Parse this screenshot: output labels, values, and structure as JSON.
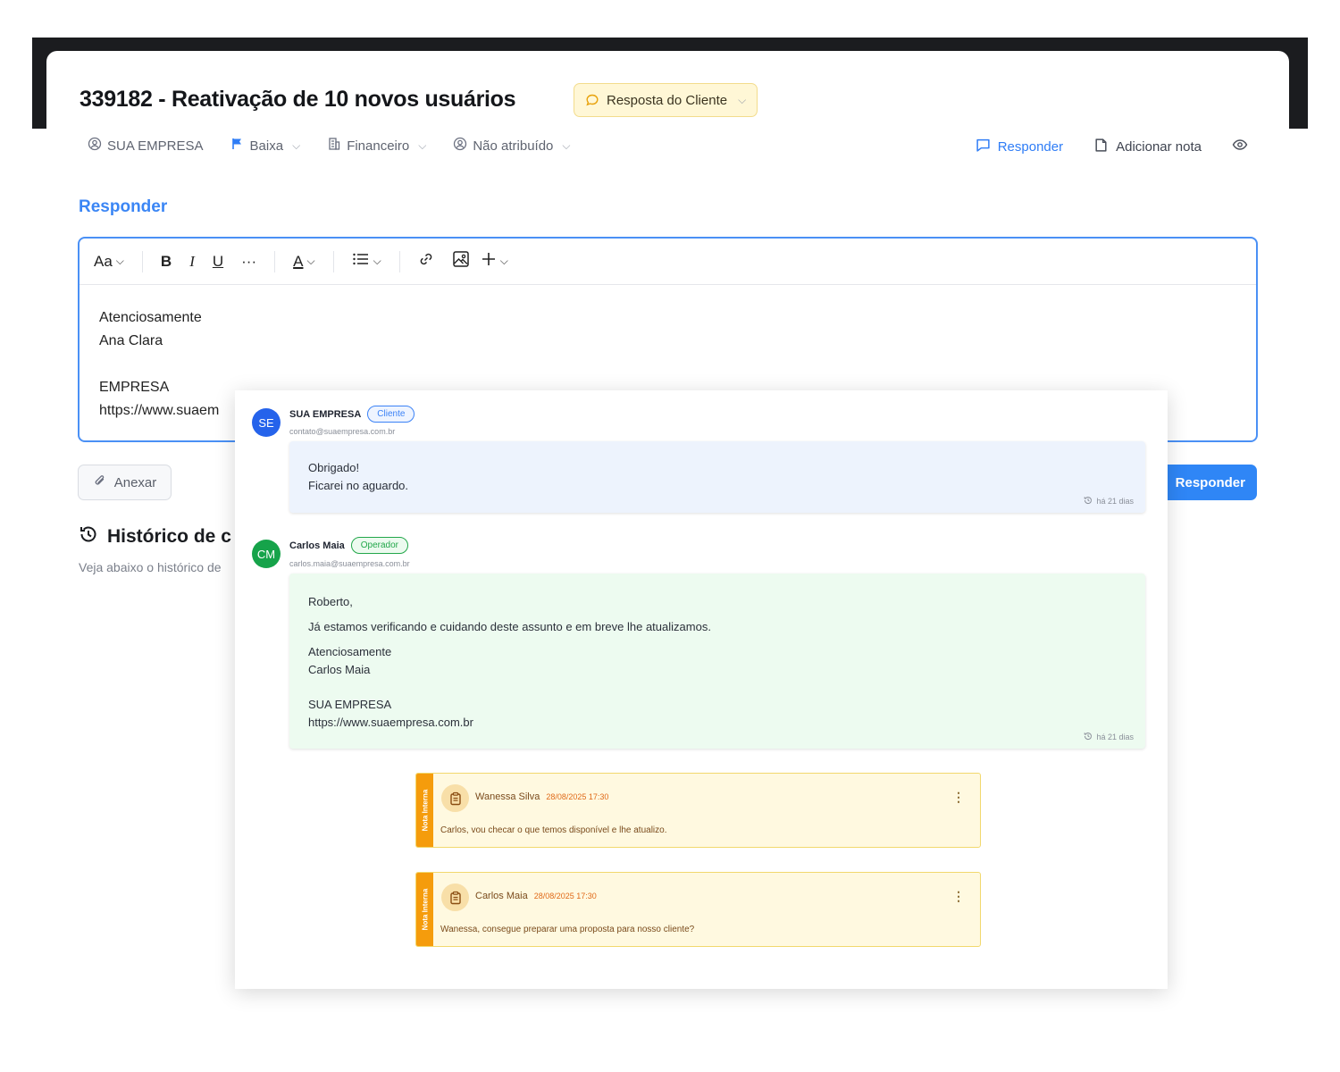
{
  "ticket": {
    "title": "339182 - Reativação de 10 novos usuários",
    "status": "Resposta do Cliente",
    "company": "SUA EMPRESA",
    "priority": "Baixa",
    "department": "Financeiro",
    "assignee": "Não atribuído"
  },
  "header_actions": {
    "reply": "Responder",
    "add_note": "Adicionar nota"
  },
  "reply_section": {
    "title": "Responder",
    "toolbar": {
      "font_size": "Aa",
      "bold": "B",
      "italic": "I",
      "underline": "U",
      "more": "···",
      "text_color": "A"
    },
    "body_lines": [
      "Atenciosamente",
      "Ana Clara",
      "",
      "EMPRESA",
      "https://www.suaem"
    ],
    "attach_label": "Anexar",
    "submit_label": "Responder"
  },
  "history": {
    "title": "Histórico de c",
    "subtitle": "Veja abaixo o histórico de"
  },
  "messages": [
    {
      "initials": "SE",
      "avatar_color": "#2563eb",
      "name": "SUA EMPRESA",
      "role": "Cliente",
      "email": "contato@suaempresa.com.br",
      "lines": [
        "Obrigado!",
        "Ficarei no aguardo."
      ],
      "time": "há 21 dias"
    },
    {
      "initials": "CM",
      "avatar_color": "#16a34a",
      "name": "Carlos Maia",
      "role": "Operador",
      "email": "carlos.maia@suaempresa.com.br",
      "greeting": "Roberto,",
      "body": "Já estamos verificando e cuidando deste assunto e em breve lhe atualizamos.",
      "sign1": "Atenciosamente",
      "sign2": "Carlos Maia",
      "sign3": "SUA EMPRESA",
      "sign4": "https://www.suaempresa.com.br",
      "time": "há 21 dias"
    }
  ],
  "notes": [
    {
      "tab": "Nota Interna",
      "author": "Wanessa Silva",
      "date": "28/08/2025 17:30",
      "text": "Carlos, vou checar o que temos disponível e lhe atualizo."
    },
    {
      "tab": "Nota Interna",
      "author": "Carlos Maia",
      "date": "28/08/2025 17:30",
      "text": "Wanessa, consegue preparar uma proposta para nosso cliente?"
    }
  ],
  "colors": {
    "accent": "#2f86f6",
    "note_tab": "#f59c0c",
    "note_bg": "#fff9e0"
  }
}
